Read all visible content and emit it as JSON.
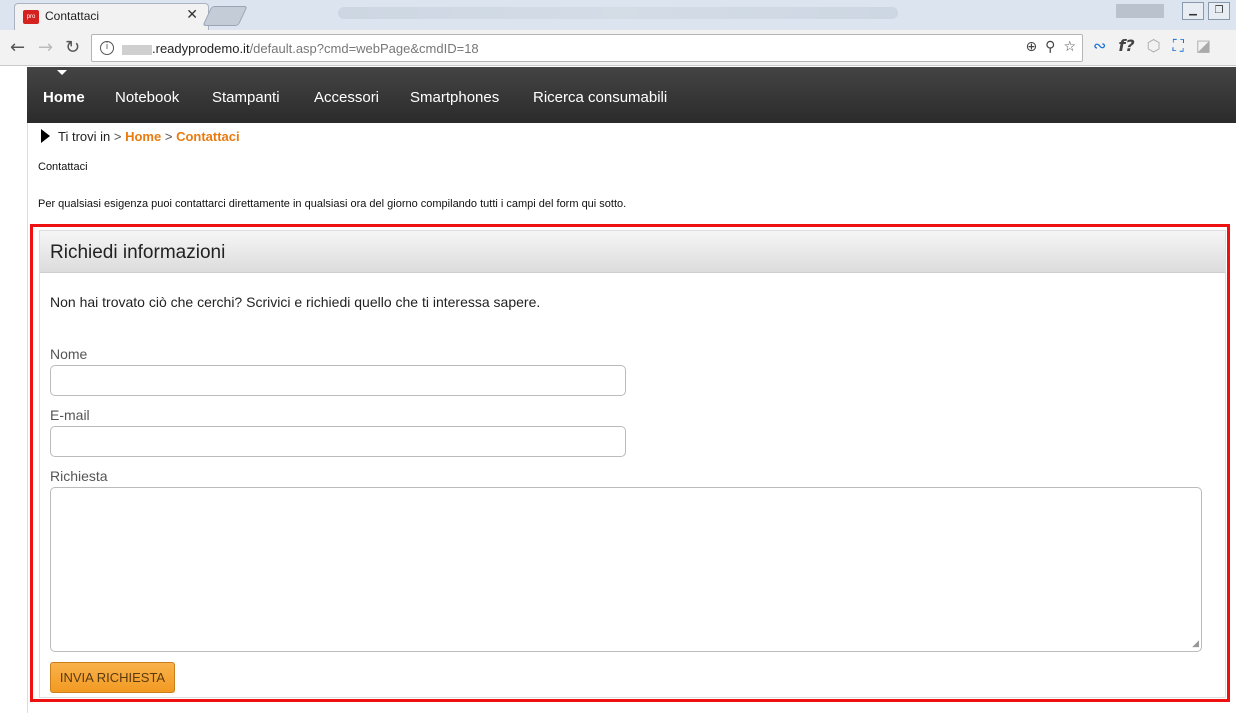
{
  "browser": {
    "tab_favicon_text": "pro",
    "tab_title": "Contattaci",
    "tab_close": "✕",
    "url_host": ".readyprodemo.it",
    "url_path": "/default.asp?cmd=webPage&cmdID=18"
  },
  "nav": {
    "items": [
      {
        "label": "Home"
      },
      {
        "label": "Notebook"
      },
      {
        "label": "Stampanti"
      },
      {
        "label": "Accessori"
      },
      {
        "label": "Smartphones"
      },
      {
        "label": "Ricerca consumabili"
      }
    ]
  },
  "breadcrumb": {
    "prefix": "Ti trovi in",
    "sep": ">",
    "home": "Home",
    "current": "Contattaci"
  },
  "page": {
    "title": "Contattaci",
    "intro": "Per qualsiasi esigenza puoi contattarci direttamente in qualsiasi ora del giorno compilando tutti i campi del form qui sotto."
  },
  "form": {
    "heading": "Richiedi informazioni",
    "description": "Non hai trovato ciò che cerchi? Scrivici e richiedi quello che ti interessa sapere.",
    "name_label": "Nome",
    "email_label": "E-mail",
    "request_label": "Richiesta",
    "submit_label": "INVIA RICHIESTA"
  },
  "colors": {
    "accent": "#e87b10",
    "highlight_border": "#e11111",
    "nav_bg": "#333333"
  }
}
